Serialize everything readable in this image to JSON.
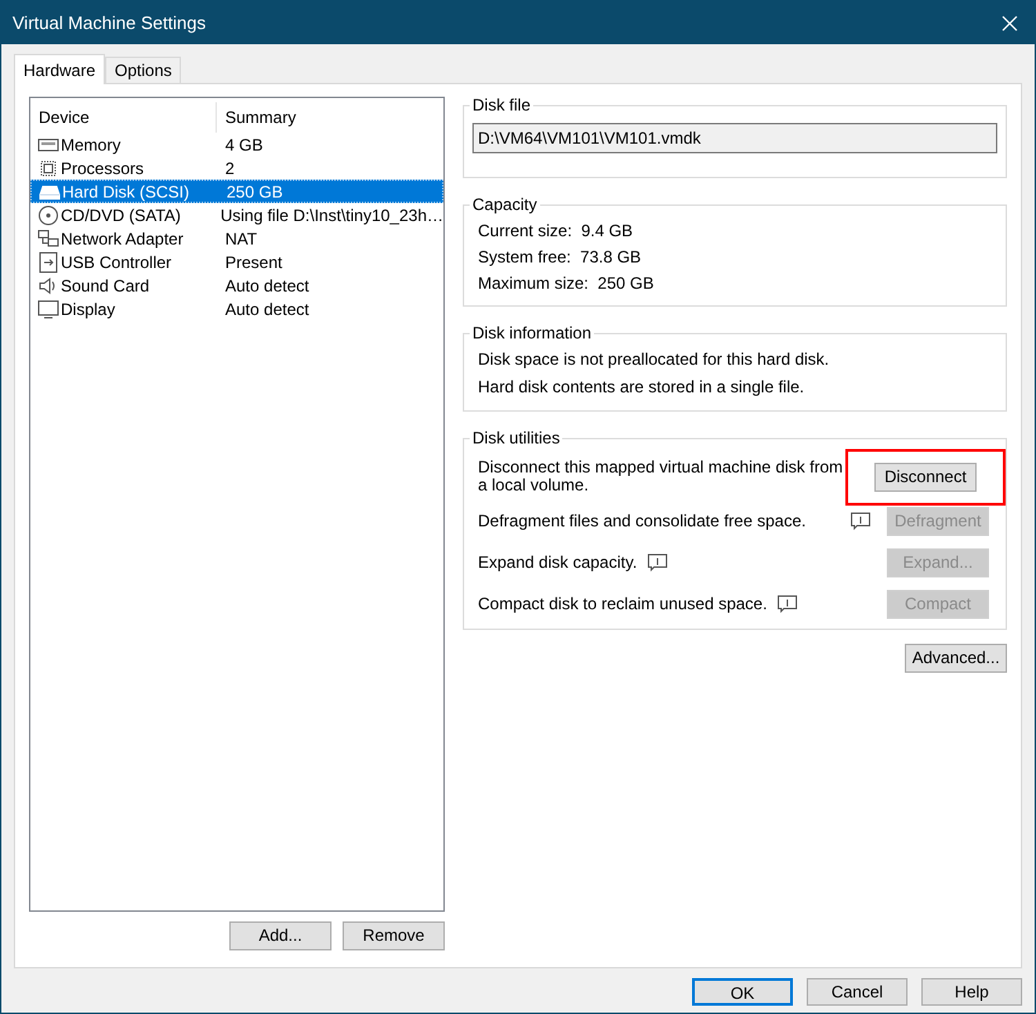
{
  "window": {
    "title": "Virtual Machine Settings"
  },
  "tabs": [
    {
      "label": "Hardware",
      "selected": true
    },
    {
      "label": "Options",
      "selected": false
    }
  ],
  "device_list": {
    "columns": [
      "Device",
      "Summary"
    ],
    "rows": [
      {
        "kind": "memory",
        "device": "Memory",
        "summary": "4 GB",
        "selected": false
      },
      {
        "kind": "processor",
        "device": "Processors",
        "summary": "2",
        "selected": false
      },
      {
        "kind": "disk",
        "device": "Hard Disk (SCSI)",
        "summary": "250 GB",
        "selected": true
      },
      {
        "kind": "cd",
        "device": "CD/DVD (SATA)",
        "summary": "Using file D:\\Inst\\tiny10_23h…",
        "selected": false
      },
      {
        "kind": "network",
        "device": "Network Adapter",
        "summary": "NAT",
        "selected": false
      },
      {
        "kind": "usb",
        "device": "USB Controller",
        "summary": "Present",
        "selected": false
      },
      {
        "kind": "sound",
        "device": "Sound Card",
        "summary": "Auto detect",
        "selected": false
      },
      {
        "kind": "display",
        "device": "Display",
        "summary": "Auto detect",
        "selected": false
      }
    ]
  },
  "list_buttons": [
    "Add...",
    "Remove"
  ],
  "disk_file": {
    "title": "Disk file",
    "value": "D:\\VM64\\VM101\\VM101.vmdk"
  },
  "capacity": {
    "title": "Capacity",
    "lines": [
      "Current size:  9.4 GB",
      "System free:  73.8 GB",
      "Maximum size:  250 GB"
    ]
  },
  "disk_information": {
    "title": "Disk information",
    "lines": [
      "Disk space is not preallocated for this hard disk.",
      "Hard disk contents are stored in a single file."
    ]
  },
  "disk_utilities": {
    "title": "Disk utilities",
    "rows": [
      {
        "text": "Disconnect this mapped virtual machine disk from a local volume.",
        "kind": "plain",
        "button": "Disconnect",
        "disabled": false,
        "highlighted": true
      },
      {
        "text": "Defragment files and consolidate free space.",
        "kind": "info_right",
        "button": "Defragment",
        "disabled": true,
        "highlighted": false
      },
      {
        "text": "Expand disk capacity.",
        "kind": "info_inline",
        "button": "Expand...",
        "disabled": true,
        "highlighted": false
      },
      {
        "text": "Compact disk to reclaim unused space.",
        "kind": "info_inline",
        "button": "Compact",
        "disabled": true,
        "highlighted": false
      }
    ]
  },
  "advanced_button": "Advanced...",
  "dialog_buttons": [
    {
      "label": "OK",
      "default": true
    },
    {
      "label": "Cancel",
      "default": false
    },
    {
      "label": "Help",
      "default": false
    }
  ]
}
